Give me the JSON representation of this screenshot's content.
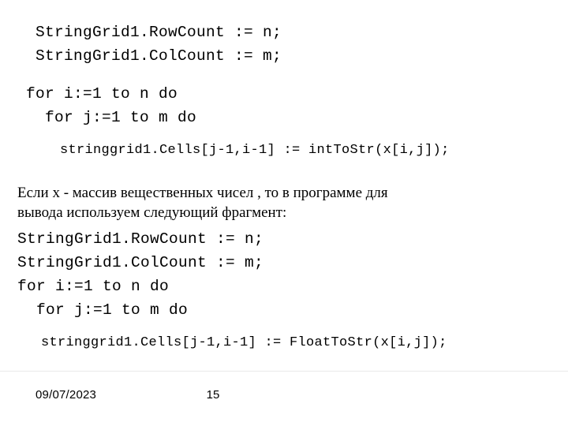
{
  "slide": {
    "background_color": "#ffffff",
    "text_color": "#000000",
    "code_block_1": {
      "lines": [
        "StringGrid1.RowCount := n;",
        "StringGrid1.ColCount := m;",
        "for i:=1 to n do",
        "for j:=1 to m do",
        "stringgrid1.Cells[j-1,i-1] := intToStr(x[i,j]);"
      ]
    },
    "paragraph": {
      "line_1": "Если x - массив вещественных  чисел , то  в  программе  для",
      "line_2": "вывода используем следующий фрагмент:"
    },
    "code_block_2": {
      "lines": [
        "StringGrid1.RowCount := n;",
        "StringGrid1.ColCount := m;",
        "for i:=1 to n do",
        "for j:=1 to m do",
        "stringgrid1.Cells[j-1,i-1] := FloatToStr(x[i,j]);"
      ]
    },
    "footer": {
      "date": "09/07/2023",
      "slide_number": "15"
    }
  }
}
